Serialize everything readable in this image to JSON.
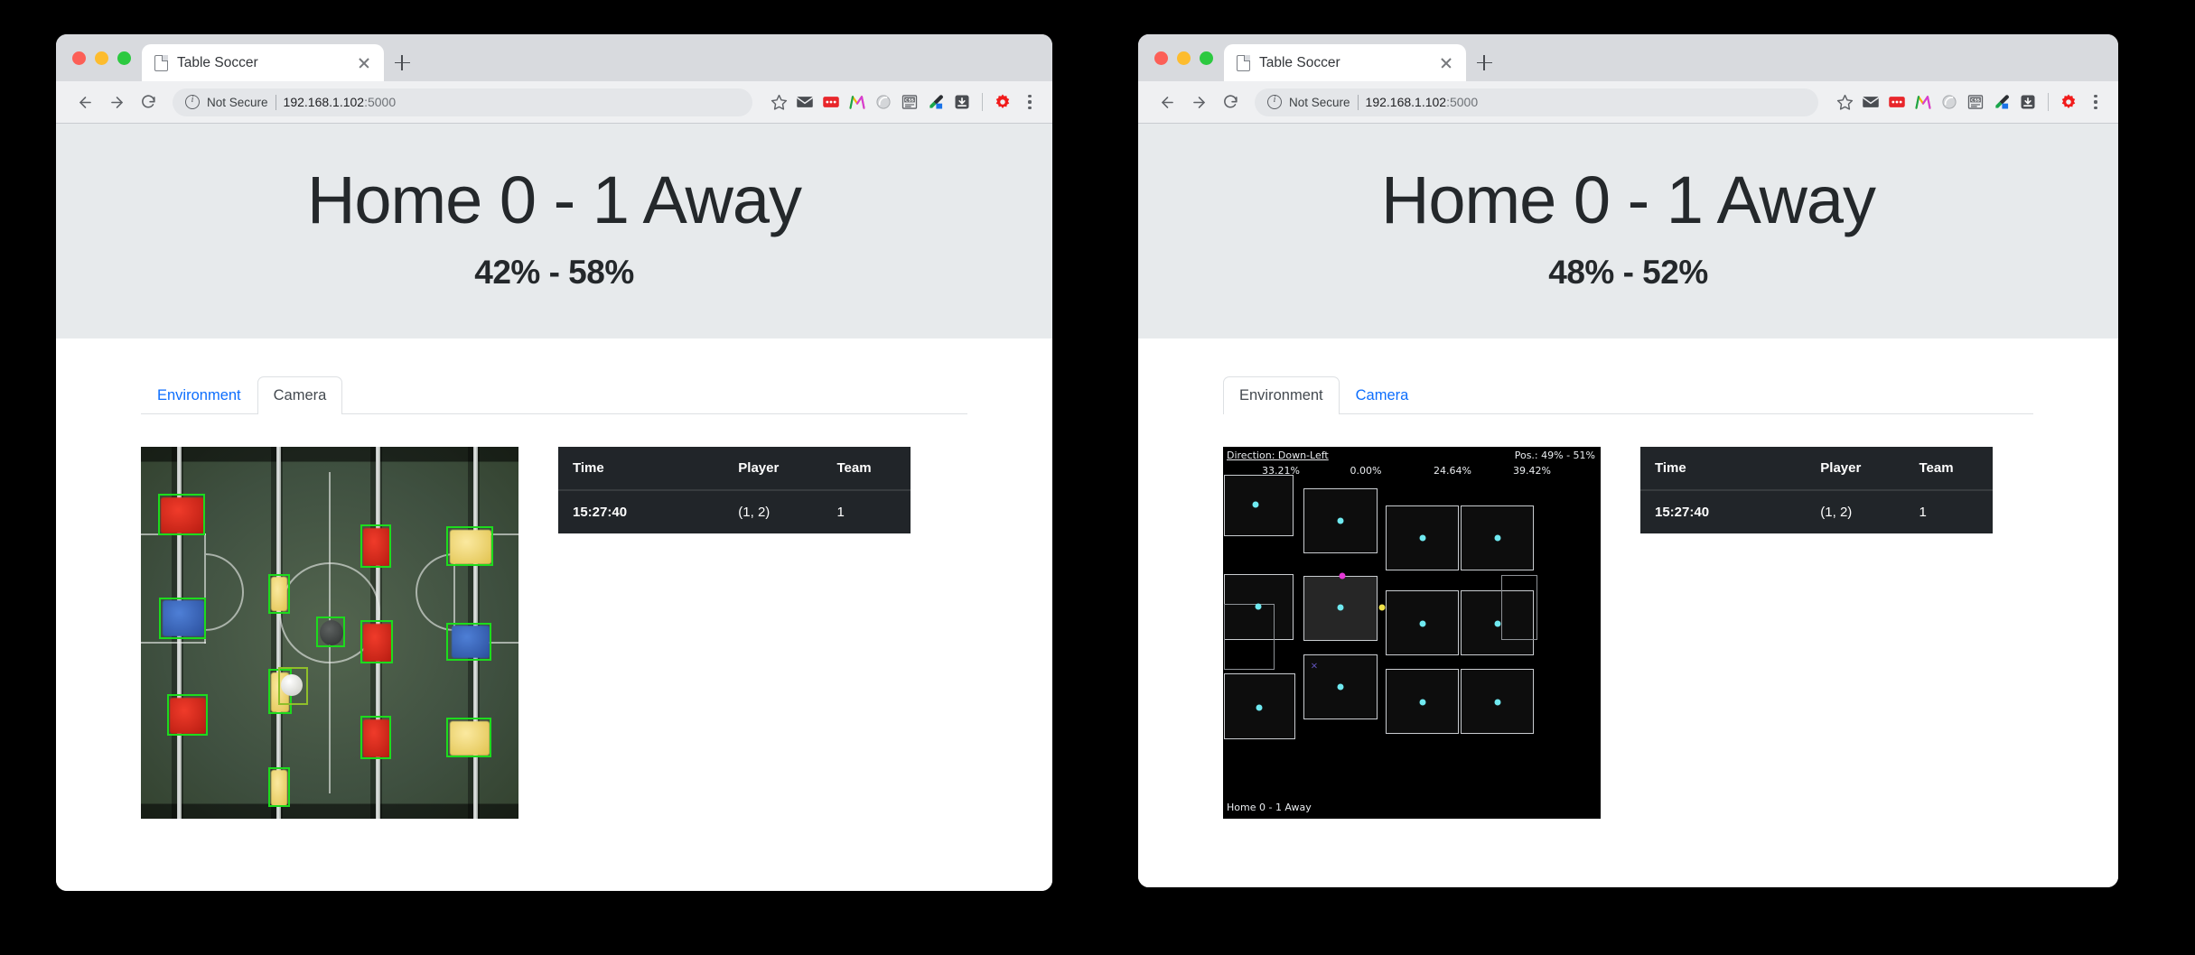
{
  "windows": [
    {
      "id": "left",
      "browser": {
        "tab_title": "Table Soccer",
        "security_label": "Not Secure",
        "url_host": "192.168.1.102",
        "url_port": ":5000",
        "icons": {
          "back": "back-arrow-icon",
          "forward": "forward-arrow-icon",
          "reload": "reload-icon",
          "info": "info-icon",
          "bookmark": "star-icon",
          "new_tab": "plus-icon",
          "close_tab": "close-icon",
          "menu": "kebab-menu-icon",
          "extensions": [
            "mail-extension-icon",
            "red-badge-extension-icon",
            "m-logo-extension-icon",
            "grey-circle-extension-icon",
            "css-extension-icon",
            "eyedropper-extension-icon",
            "download-extension-icon",
            "red-gear-extension-icon"
          ]
        }
      },
      "header": {
        "score": "Home 0 - 1 Away",
        "possession": "42% - 58%"
      },
      "tabs": [
        {
          "label": "Environment",
          "active": false
        },
        {
          "label": "Camera",
          "active": true
        }
      ],
      "active_view": "camera",
      "events": {
        "columns": [
          "Time",
          "Player",
          "Team"
        ],
        "rows": [
          {
            "time": "15:27:40",
            "player": "(1, 2)",
            "team": "1"
          }
        ]
      }
    },
    {
      "id": "right",
      "browser": {
        "tab_title": "Table Soccer",
        "security_label": "Not Secure",
        "url_host": "192.168.1.102",
        "url_port": ":5000",
        "icons": {
          "back": "back-arrow-icon",
          "forward": "forward-arrow-icon",
          "reload": "reload-icon",
          "info": "info-icon",
          "bookmark": "star-icon",
          "new_tab": "plus-icon",
          "close_tab": "close-icon",
          "menu": "kebab-menu-icon",
          "extensions": [
            "mail-extension-icon",
            "red-badge-extension-icon",
            "m-logo-extension-icon",
            "grey-circle-extension-icon",
            "css-extension-icon",
            "eyedropper-extension-icon",
            "download-extension-icon",
            "red-gear-extension-icon"
          ]
        }
      },
      "header": {
        "score": "Home 0 - 1 Away",
        "possession": "48% - 52%"
      },
      "tabs": [
        {
          "label": "Environment",
          "active": true
        },
        {
          "label": "Camera",
          "active": false
        }
      ],
      "active_view": "environment",
      "environment": {
        "direction_label": "Direction: Down-Left",
        "position_label": "Pos.: 49% - 51%",
        "score_label": "Home 0 - 1 Away",
        "rod_percentages": [
          "33.21%",
          "0.00%",
          "24.64%",
          "39.42%"
        ]
      },
      "events": {
        "columns": [
          "Time",
          "Player",
          "Team"
        ],
        "rows": [
          {
            "time": "15:27:40",
            "player": "(1, 2)",
            "team": "1"
          }
        ]
      }
    }
  ],
  "colors": {
    "page_background": "#000000",
    "jumbotron": "#e7eaec",
    "link_blue": "#0d6efd",
    "table_dark": "#212529",
    "detection_green": "#1ddb1d",
    "env_dot_cyan": "#6fe9f0",
    "env_dot_magenta": "#e438d6",
    "env_dot_yellow": "#efe24a"
  }
}
